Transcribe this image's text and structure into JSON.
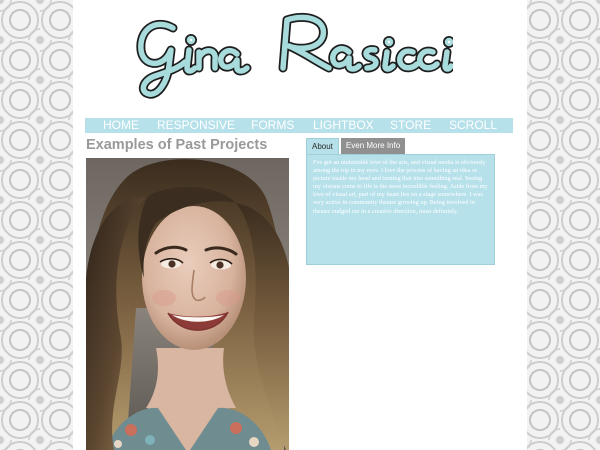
{
  "site": {
    "logo_text": "Gina Rasicci"
  },
  "nav": {
    "items": [
      {
        "label": "HOME"
      },
      {
        "label": "RESPONSIVE"
      },
      {
        "label": "FORMS"
      },
      {
        "label": "LIGHTBOX"
      },
      {
        "label": "STORE"
      },
      {
        "label": "SCROLL"
      }
    ]
  },
  "main": {
    "heading": "Examples of Past Projects"
  },
  "info": {
    "tabs": [
      {
        "label": "About",
        "active": true
      },
      {
        "label": "Even More Info",
        "active": false
      }
    ],
    "about_text": "I've got an undeniable love of the arts, and visual media is obviously among the top in my eyes. I love the process of having an idea or picture inside my head and turning that into something real. Seeing my visions come to life is the most incredible feeling. Aside from my love of visual art, part of my heart lies on a stage somewhere. I was very active in community theatre growing up. Being involved in theatre nudged me in a creative direction, most definitely."
  },
  "colors": {
    "accent": "#b6e1ea",
    "logo_fill": "#a8dcdc",
    "logo_stroke": "#1e1e1e",
    "heading": "#999999"
  }
}
